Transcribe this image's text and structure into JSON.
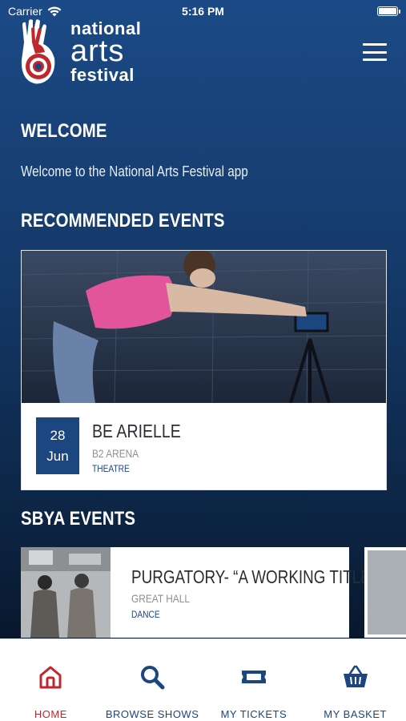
{
  "status": {
    "carrier": "Carrier",
    "time": "5:16 PM",
    "battery_level": 1.0
  },
  "logo": {
    "line1": "national",
    "line2": "arts",
    "line3": "festival"
  },
  "welcome": {
    "title": "WELCOME",
    "text": "Welcome to the National Arts Festival app"
  },
  "recommended": {
    "title": "RECOMMENDED EVENTS",
    "event": {
      "day": "28",
      "month": "Jun",
      "title": "BE ARIELLE",
      "venue": "B2 ARENA",
      "category": "THEATRE"
    }
  },
  "sbya": {
    "title": "SBYA EVENTS",
    "events": [
      {
        "title": "PURGATORY- “A WORKING TITLE”",
        "venue": "GREAT HALL",
        "category": "DANCE"
      }
    ]
  },
  "tabs": [
    {
      "label": "HOME",
      "icon": "home-icon",
      "active": true
    },
    {
      "label": "BROWSE SHOWS",
      "icon": "search-icon",
      "active": false
    },
    {
      "label": "MY TICKETS",
      "icon": "ticket-icon",
      "active": false
    },
    {
      "label": "MY BASKET",
      "icon": "basket-icon",
      "active": false
    }
  ],
  "colors": {
    "brand_blue": "#1b4680",
    "active_red": "#c0272d"
  }
}
